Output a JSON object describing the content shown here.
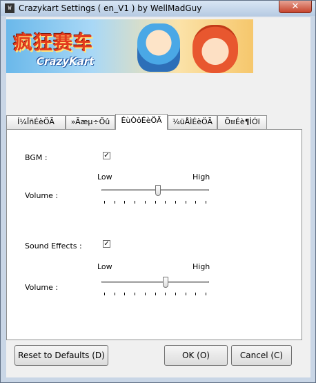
{
  "window": {
    "title": "Crazykart Settings ( en_V1 ) by WellMadGuy",
    "icon_label": "W",
    "close_glyph": "✕"
  },
  "banner": {
    "logo_cn": "疯狂赛车",
    "logo_en": "CrazyKart"
  },
  "tabs": [
    {
      "label": "Í¼ÏñÉèÖÃ",
      "active": false
    },
    {
      "label": "»­Ãæµ÷Õû",
      "active": false
    },
    {
      "label": "ÉùÒôÉèÖÃ",
      "active": true
    },
    {
      "label": "¼üÅÌÉèÖÃ",
      "active": false
    },
    {
      "label": "Õ¤Éè¶ÌÓï",
      "active": false
    }
  ],
  "sound": {
    "bgm": {
      "label": "BGM :",
      "checked": true,
      "check_glyph": "✓",
      "volume_label": "Volume :",
      "low_label": "Low",
      "high_label": "High",
      "level": 0.53
    },
    "effects": {
      "label": "Sound Effects :",
      "checked": true,
      "check_glyph": "✓",
      "volume_label": "Volume :",
      "low_label": "Low",
      "high_label": "High",
      "level": 0.6
    }
  },
  "buttons": {
    "reset": "Reset to Defaults (D)",
    "ok": "OK (O)",
    "cancel": "Cancel (C)"
  },
  "colors": {
    "accent_close": "#c7442d",
    "panel_bg": "#ffffff",
    "dialog_bg": "#f0f0f0"
  }
}
